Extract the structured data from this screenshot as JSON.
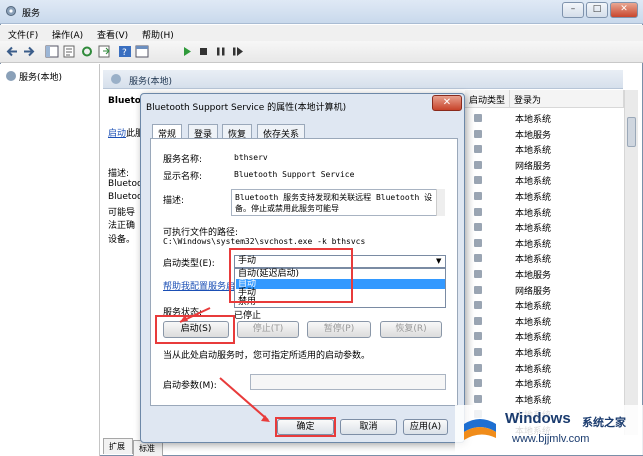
{
  "window": {
    "title": "服务",
    "minimize": "–",
    "maximize": "□",
    "close": "✕"
  },
  "menu": [
    "文件(F)",
    "操作(A)",
    "查看(V)",
    "帮助(H)"
  ],
  "tree": {
    "root": "服务(本地)"
  },
  "pane": {
    "header": "服务(本地)",
    "service_title": "Blueto",
    "start_link": "启动",
    "start_link_suffix": "此服",
    "desc_lines": [
      "描述:",
      "Bluetoo",
      "Bluetoo",
      "可能导",
      "法正确",
      "设备。"
    ]
  },
  "columns": {
    "startup_type": "启动类型",
    "login_as": "登录为"
  },
  "rows": [
    "本地系统",
    "本地服务",
    "本地系统",
    "网络服务",
    "本地系统",
    "本地系统",
    "本地系统",
    "本地系统",
    "本地系统",
    "本地系统",
    "本地服务",
    "网络服务",
    "本地系统",
    "本地系统",
    "本地系统",
    "本地系统",
    "本地系统",
    "本地系统",
    "本地系统",
    "本地系统",
    "本地系统"
  ],
  "bottom_tabs": [
    "扩展",
    "标准"
  ],
  "dialog": {
    "title": "Bluetooth Support Service 的属性(本地计算机)",
    "tabs": [
      "常规",
      "登录",
      "恢复",
      "依存关系"
    ],
    "service_name_label": "服务名称:",
    "service_name": "bthserv",
    "display_name_label": "显示名称:",
    "display_name": "Bluetooth Support Service",
    "description_label": "描述:",
    "description": "Bluetooth 服务支持发现和关联远程 Bluetooth 设备。停止或禁用此服务可能导",
    "exec_path_label": "可执行文件的路径:",
    "exec_path": "C:\\Windows\\system32\\svchost.exe -k bthsvcs",
    "startup_type_label": "启动类型(E):",
    "startup_type_value": "手动",
    "startup_options": [
      "自动(延迟启动)",
      "自动",
      "手动",
      "禁用"
    ],
    "help_link": "帮助我配置服务启",
    "status_label": "服务状态:",
    "status_value": "已停止",
    "buttons": {
      "start": "启动(S)",
      "stop": "停止(T)",
      "pause": "暂停(P)",
      "resume": "恢复(R)"
    },
    "hint": "当从此处启动服务时，您可指定所适用的启动参数。",
    "params_label": "启动参数(M):",
    "ok": "确定",
    "cancel": "取消",
    "apply": "应用(A)"
  },
  "watermark": {
    "brand": "Windows",
    "cn": "系统之家",
    "url": "www.bjjmlv.com"
  },
  "colors": {
    "highlight_red": "#e83b3b",
    "selection_blue": "#3399ff",
    "link_blue": "#1b4fb5"
  }
}
